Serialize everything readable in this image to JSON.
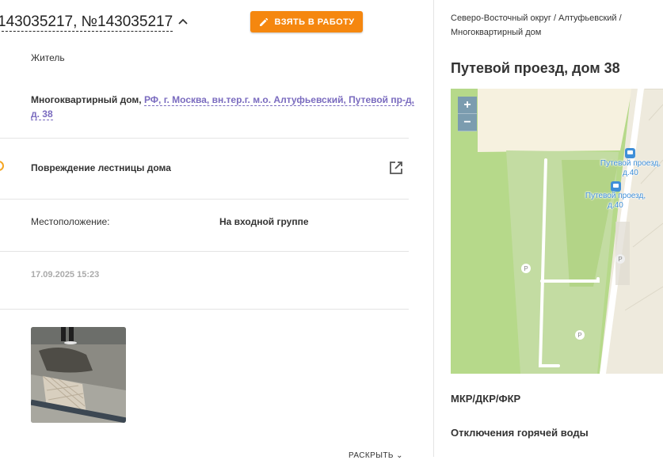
{
  "header": {
    "title": "143035217, №143035217",
    "take_button_label": "ВЗЯТЬ В РАБОТУ"
  },
  "request": {
    "role": "Житель",
    "address_prefix": "Многоквартирный дом,",
    "address_link": "РФ, г. Москва, вн.тер.г. м.о. Алтуфьевский, Путевой пр-д, д. 38",
    "issue": "Повреждение лестницы дома",
    "location_label": "Местоположение:",
    "location_value": "На входной группе",
    "date": "17.09.2025 15:23",
    "expand_label": "РАСКРЫТЬ"
  },
  "sidebar": {
    "breadcrumb": "Северо-Восточный округ / Алтуфьевский / Многоквартирный дом",
    "place_title": "Путевой проезд, дом 38",
    "map": {
      "zoom_in": "+",
      "zoom_out": "−",
      "stop1": "Путевой проезд, д.40",
      "stop2": "Путевой проезд, д.40",
      "parking": "P"
    },
    "section1": "МКР/ДКР/ФКР",
    "section2": "Отключения горячей воды"
  },
  "colors": {
    "accent": "#f5870f",
    "link": "#7a6bbf",
    "map_label": "#3f8fd8"
  }
}
